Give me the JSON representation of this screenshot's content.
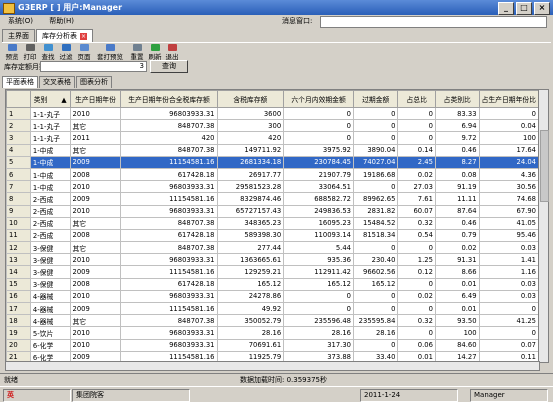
{
  "window": {
    "title": "G3ERP [ ] 用户:Manager",
    "buttons": [
      "_",
      "□",
      "×"
    ]
  },
  "menu": [
    "系统(O)",
    "帮助(H)"
  ],
  "message_label": "消息窗口:",
  "tabs": [
    "主界面",
    "库存分析表"
  ],
  "toolbar": [
    "预览",
    "打印",
    "查找",
    "过滤",
    "页面",
    "套打预览",
    "重置",
    "刷新",
    "退出"
  ],
  "filter": {
    "label": "库存定额月数",
    "value": "3",
    "query_btn": "查询"
  },
  "subtabs": [
    "平面表格",
    "交叉表格",
    "图表分析"
  ],
  "grid": {
    "headers": [
      "",
      "类别",
      "生产日期年份",
      "生产日期年份合全税库存额",
      "含税库存额",
      "六个月内效期金额",
      "过期金额",
      "占总比",
      "占类别比",
      "占生产日期年份比"
    ],
    "sort_indicator": "▲",
    "selected_row": 4,
    "rows": [
      [
        "1",
        "1-1-丸子",
        "2010",
        "96803933.31",
        "3600",
        "0",
        "0",
        "0",
        "83.33",
        "0"
      ],
      [
        "2",
        "1-1-丸子",
        "其它",
        "848707.38",
        "300",
        "0",
        "0",
        "0",
        "6.94",
        "0.04"
      ],
      [
        "3",
        "1-1-丸子",
        "2011",
        "420",
        "420",
        "0",
        "0",
        "0",
        "9.72",
        "100"
      ],
      [
        "4",
        "1-中成",
        "其它",
        "848707.38",
        "149711.92",
        "3975.92",
        "3890.04",
        "0.14",
        "0.46",
        "17.64"
      ],
      [
        "5",
        "1-中成",
        "2009",
        "11154581.16",
        "2681334.18",
        "230784.45",
        "74027.04",
        "2.45",
        "8.27",
        "24.04"
      ],
      [
        "6",
        "1-中成",
        "2008",
        "617428.18",
        "26917.77",
        "21907.79",
        "19186.68",
        "0.02",
        "0.08",
        "4.36"
      ],
      [
        "7",
        "1-中成",
        "2010",
        "96803933.31",
        "29581523.28",
        "33064.51",
        "0",
        "27.03",
        "91.19",
        "30.56"
      ],
      [
        "8",
        "2-西成",
        "2009",
        "11154581.16",
        "8329874.46",
        "688582.72",
        "89962.65",
        "7.61",
        "11.11",
        "74.68"
      ],
      [
        "9",
        "2-西成",
        "2010",
        "96803933.31",
        "65727157.43",
        "249836.53",
        "2831.82",
        "60.07",
        "87.64",
        "67.90"
      ],
      [
        "10",
        "2-西成",
        "其它",
        "848707.38",
        "348365.23",
        "16095.23",
        "15484.52",
        "0.32",
        "0.46",
        "41.05"
      ],
      [
        "11",
        "2-西成",
        "2008",
        "617428.18",
        "589398.30",
        "110093.14",
        "81518.34",
        "0.54",
        "0.79",
        "95.46"
      ],
      [
        "12",
        "3-保健",
        "其它",
        "848707.38",
        "277.44",
        "5.44",
        "0",
        "0",
        "0.02",
        "0.03"
      ],
      [
        "13",
        "3-保健",
        "2010",
        "96803933.31",
        "1363665.61",
        "935.36",
        "230.40",
        "1.25",
        "91.31",
        "1.41"
      ],
      [
        "14",
        "3-保健",
        "2009",
        "11154581.16",
        "129259.21",
        "112911.42",
        "96602.56",
        "0.12",
        "8.66",
        "1.16"
      ],
      [
        "15",
        "3-保健",
        "2008",
        "617428.18",
        "165.12",
        "165.12",
        "165.12",
        "0",
        "0.01",
        "0.03"
      ],
      [
        "16",
        "4-器械",
        "2010",
        "96803933.31",
        "24278.86",
        "0",
        "0",
        "0.02",
        "6.49",
        "0.03"
      ],
      [
        "17",
        "4-器械",
        "2009",
        "11154581.16",
        "49.92",
        "0",
        "0",
        "0",
        "0.01",
        "0"
      ],
      [
        "18",
        "4-器械",
        "其它",
        "848707.38",
        "350052.79",
        "235596.48",
        "235595.84",
        "0.32",
        "93.50",
        "41.25"
      ],
      [
        "19",
        "5-饮片",
        "2010",
        "96803933.31",
        "28.16",
        "28.16",
        "28.16",
        "0",
        "100",
        "0"
      ],
      [
        "20",
        "6-化学",
        "2010",
        "96803933.31",
        "70691.61",
        "317.30",
        "0",
        "0.06",
        "84.60",
        "0.07"
      ],
      [
        "21",
        "6-化学",
        "2009",
        "11154581.16",
        "11925.79",
        "373.88",
        "33.40",
        "0.01",
        "14.27",
        "0.11"
      ],
      [
        "22",
        "",
        "",
        "",
        "",
        "",
        "",
        "",
        "",
        ""
      ]
    ]
  },
  "status": {
    "left": "就绪",
    "load_time": "数据加载时间: 0.359375秒"
  },
  "taskbar": {
    "brand": "英",
    "company": "集团院客",
    "date": "2011-1-24",
    "user": "Manager"
  }
}
